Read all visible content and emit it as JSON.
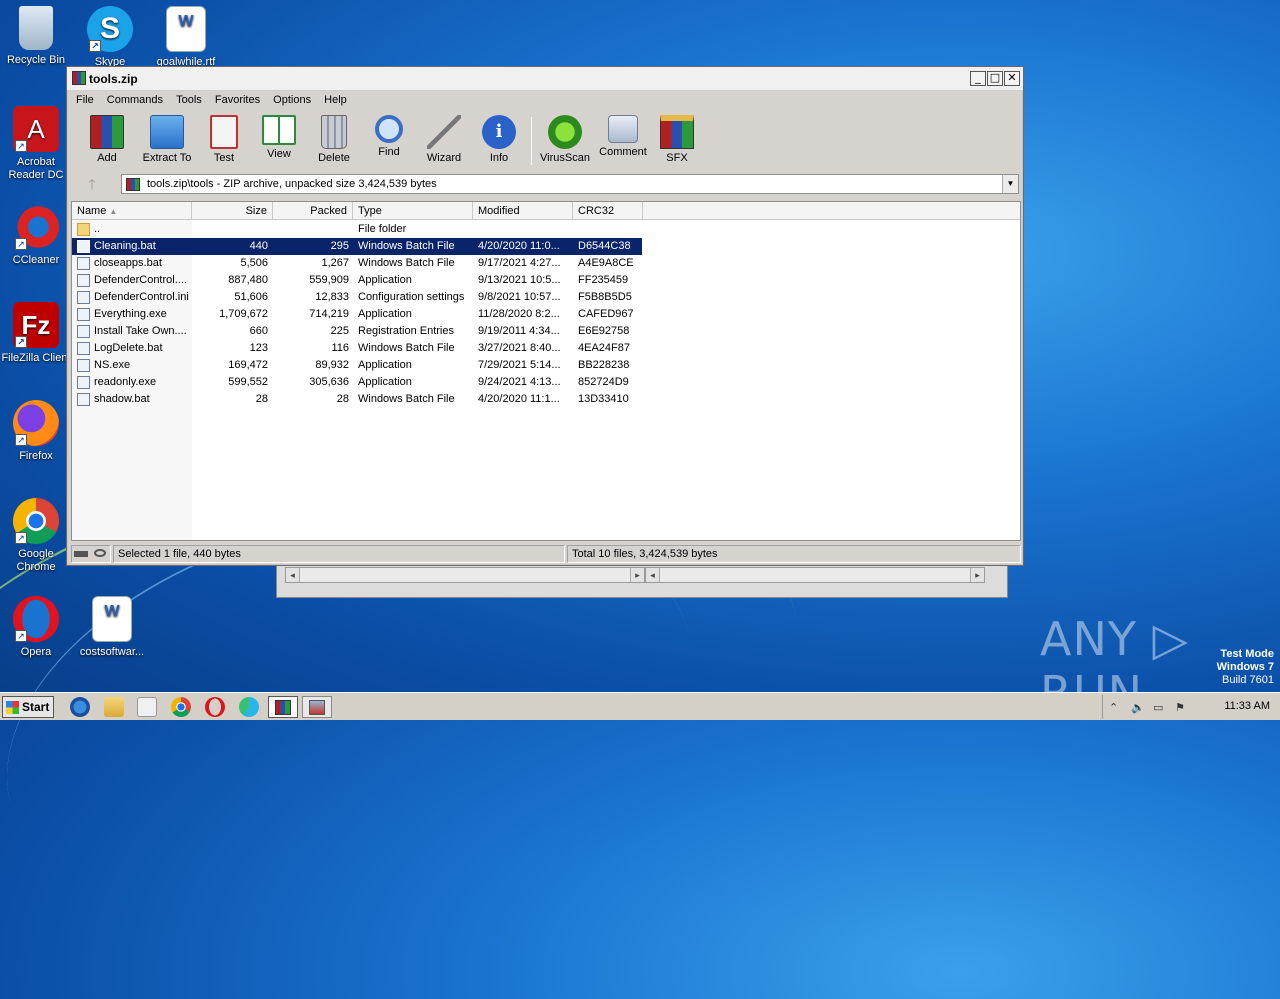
{
  "desktop": {
    "icons": [
      {
        "label": "Recycle Bin"
      },
      {
        "label": "Skype"
      },
      {
        "label": "goalwhile.rtf"
      },
      {
        "label": "Acrobat Reader DC"
      },
      {
        "label": "CCleaner"
      },
      {
        "label": "FileZilla Client"
      },
      {
        "label": "Firefox"
      },
      {
        "label": "Google Chrome"
      },
      {
        "label": "Opera"
      },
      {
        "label": "costsoftwar..."
      }
    ],
    "watermark": "ANY ▷ RUN",
    "test_mode": {
      "line1": "Test Mode",
      "line2": "Windows 7",
      "line3": "Build 7601"
    }
  },
  "window": {
    "title": "tools.zip",
    "controls": {
      "minimize": "_",
      "maximize": "□",
      "close": "✕"
    },
    "menu": [
      "File",
      "Commands",
      "Tools",
      "Favorites",
      "Options",
      "Help"
    ],
    "toolbar": [
      {
        "label": "Add",
        "icon": "add-archive-icon"
      },
      {
        "label": "Extract To",
        "icon": "extract-folder-icon"
      },
      {
        "label": "Test",
        "icon": "test-clipboard-icon"
      },
      {
        "label": "View",
        "icon": "view-book-icon"
      },
      {
        "label": "Delete",
        "icon": "trash-icon"
      },
      {
        "label": "Find",
        "icon": "magnifier-icon"
      },
      {
        "label": "Wizard",
        "icon": "magic-wand-icon"
      },
      {
        "label": "Info",
        "icon": "info-icon"
      },
      {
        "label": "VirusScan",
        "icon": "virus-bug-icon"
      },
      {
        "label": "Comment",
        "icon": "comment-icon"
      },
      {
        "label": "SFX",
        "icon": "sfx-box-icon"
      }
    ],
    "address": "tools.zip\\tools - ZIP archive, unpacked size 3,424,539 bytes",
    "columns": {
      "name": "Name",
      "size": "Size",
      "packed": "Packed",
      "type": "Type",
      "modified": "Modified",
      "crc": "CRC32"
    },
    "parent_row": {
      "name": "..",
      "type": "File folder"
    },
    "files": [
      {
        "name": "Cleaning.bat",
        "size": "440",
        "packed": "295",
        "type": "Windows Batch File",
        "modified": "4/20/2020 11:0...",
        "crc": "D6544C38"
      },
      {
        "name": "closeapps.bat",
        "size": "5,506",
        "packed": "1,267",
        "type": "Windows Batch File",
        "modified": "9/17/2021 4:27...",
        "crc": "A4E9A8CE"
      },
      {
        "name": "DefenderControl....",
        "size": "887,480",
        "packed": "559,909",
        "type": "Application",
        "modified": "9/13/2021 10:5...",
        "crc": "FF235459"
      },
      {
        "name": "DefenderControl.ini",
        "size": "51,606",
        "packed": "12,833",
        "type": "Configuration settings",
        "modified": "9/8/2021 10:57...",
        "crc": "F5B8B5D5"
      },
      {
        "name": "Everything.exe",
        "size": "1,709,672",
        "packed": "714,219",
        "type": "Application",
        "modified": "11/28/2020 8:2...",
        "crc": "CAFED967"
      },
      {
        "name": "Install Take Own....",
        "size": "660",
        "packed": "225",
        "type": "Registration Entries",
        "modified": "9/19/2011 4:34...",
        "crc": "E6E92758"
      },
      {
        "name": "LogDelete.bat",
        "size": "123",
        "packed": "116",
        "type": "Windows Batch File",
        "modified": "3/27/2021 8:40...",
        "crc": "4EA24F87"
      },
      {
        "name": "NS.exe",
        "size": "169,472",
        "packed": "89,932",
        "type": "Application",
        "modified": "7/29/2021 5:14...",
        "crc": "BB228238"
      },
      {
        "name": "readonly.exe",
        "size": "599,552",
        "packed": "305,636",
        "type": "Application",
        "modified": "9/24/2021 4:13...",
        "crc": "852724D9"
      },
      {
        "name": "shadow.bat",
        "size": "28",
        "packed": "28",
        "type": "Windows Batch File",
        "modified": "4/20/2020 11:1...",
        "crc": "13D33410"
      }
    ],
    "status_left": "Selected 1 file, 440 bytes",
    "status_right": "Total 10 files, 3,424,539 bytes"
  },
  "taskbar": {
    "start_label": "Start",
    "clock": "11:33 AM"
  }
}
